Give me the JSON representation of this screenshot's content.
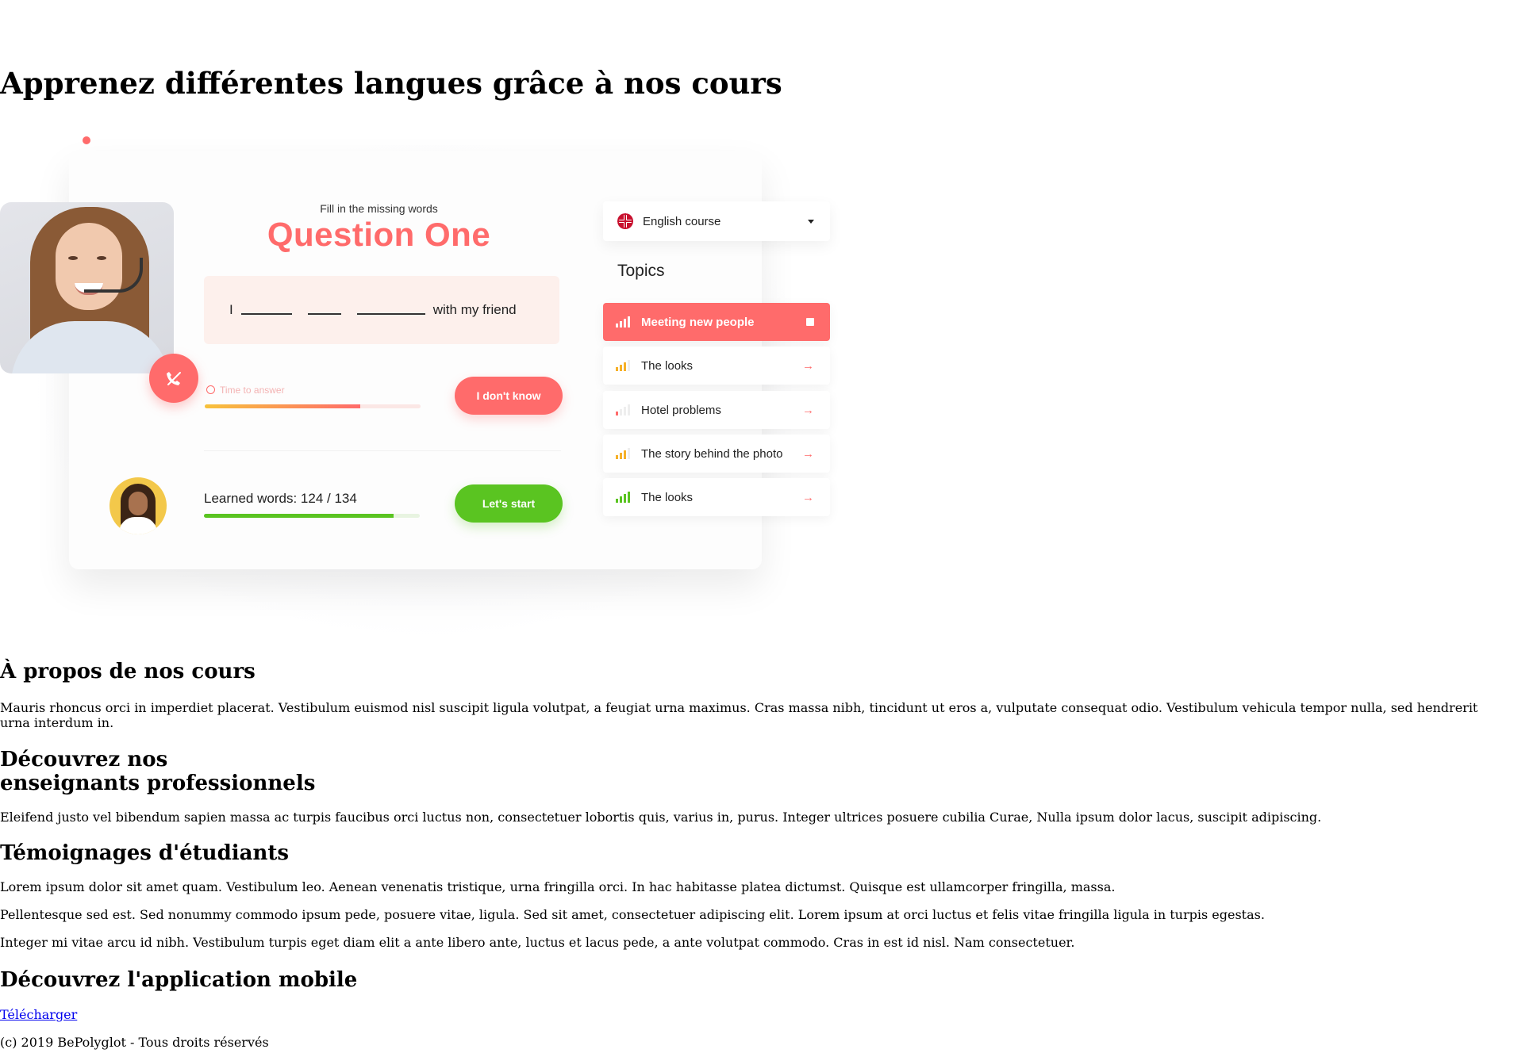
{
  "hero": {
    "title": "Apprenez différentes langues grâce à nos cours"
  },
  "illustration": {
    "question": {
      "subtitle": "Fill in the missing words",
      "title": "Question One",
      "sentence_start": "I",
      "sentence_end": "with my friend"
    },
    "timer": {
      "label": "Time to answer",
      "progress": 0.72
    },
    "buttons": {
      "dont_know": "I don't know",
      "start": "Let's start"
    },
    "learned": {
      "label": "Learned words: 124 / 134",
      "progress": 0.88
    },
    "course_select": {
      "value": "English course"
    },
    "topics_heading": "Topics",
    "topics": [
      {
        "label": "Meeting new people",
        "active": true,
        "level": 4
      },
      {
        "label": "The looks",
        "active": false,
        "level": 3
      },
      {
        "label": "Hotel problems",
        "active": false,
        "level": 1
      },
      {
        "label": "The story behind the photo",
        "active": false,
        "level": 3
      },
      {
        "label": "The looks",
        "active": false,
        "level": 4
      }
    ],
    "colors": {
      "accent": "#ff6b6b",
      "success": "#5ac421",
      "timer_start": "#f7c23b"
    }
  },
  "about": {
    "title": "À propos de nos cours",
    "text": "Mauris rhoncus orci in imperdiet placerat. Vestibulum euismod nisl suscipit ligula volutpat, a feugiat urna maximus. Cras massa nibh, tincidunt ut eros a, vulputate consequat odio. Vestibulum vehicula tempor nulla, sed hendrerit urna interdum in."
  },
  "teachers": {
    "title_line1": "Découvrez nos",
    "title_line2": "enseignants professionnels",
    "text": "Eleifend justo vel bibendum sapien massa ac turpis faucibus orci luctus non, consectetuer lobortis quis, varius in, purus. Integer ultrices posuere cubilia Curae, Nulla ipsum dolor lacus, suscipit adipiscing."
  },
  "testimonials": {
    "title": "Témoignages d'étudiants",
    "items": [
      "Lorem ipsum dolor sit amet quam. Vestibulum leo. Aenean venenatis tristique, urna fringilla orci. In hac habitasse platea dictumst. Quisque est ullamcorper fringilla, massa.",
      "Pellentesque sed est. Sed nonummy commodo ipsum pede, posuere vitae, ligula. Sed sit amet, consectetuer adipiscing elit. Lorem ipsum at orci luctus et felis vitae fringilla ligula in turpis egestas.",
      "Integer mi vitae arcu id nibh. Vestibulum turpis eget diam elit a ante libero ante, luctus et lacus pede, a ante volutpat commodo. Cras in est id nisl. Nam consectetuer."
    ]
  },
  "mobile": {
    "title": "Découvrez l'application mobile",
    "download_link": "Télécharger"
  },
  "footer": {
    "copyright": "(c) 2019 BePolyglot - Tous droits réservés"
  }
}
